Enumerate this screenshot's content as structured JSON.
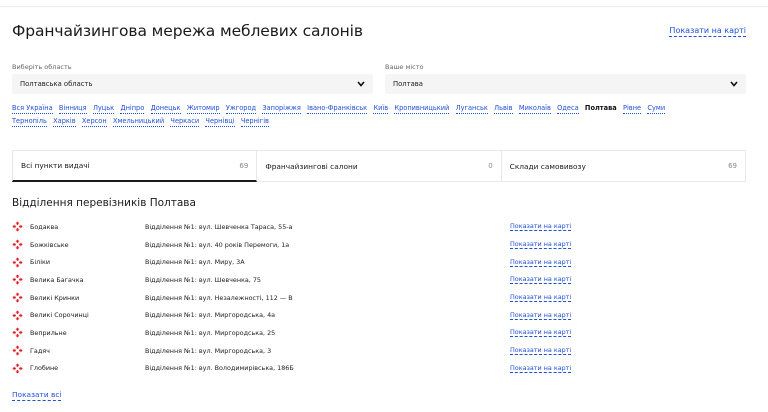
{
  "header": {
    "title": "Франчайзингова мережа меблевих салонів",
    "map_link": "Показати на карті"
  },
  "filters": {
    "region_label": "Виберіть область",
    "region_value": "Полтавська область",
    "city_label": "Ваше місто",
    "city_value": "Полтава"
  },
  "cities_row1": [
    "Вся Україна",
    "Вінниця",
    "Луцьк",
    "Дніпро",
    "Донецьк",
    "Житомир",
    "Ужгород",
    "Запоріжжя",
    "Івано-Франківськ",
    "Київ",
    "Кропивницький",
    "Луганськ",
    "Львів",
    "Миколаїв",
    "Одеса",
    "Полтава",
    "Рівне",
    "Суми"
  ],
  "cities_row2": [
    "Тернопіль",
    "Харків",
    "Херсон",
    "Хмельницький",
    "Черкаси",
    "Чернівці",
    "Чернігів"
  ],
  "active_city": "Полтава",
  "tabs": [
    {
      "label": "Всі пункти видачі",
      "count": "69"
    },
    {
      "label": "Франчайзингові салони",
      "count": "0"
    },
    {
      "label": "Склади самовивозу",
      "count": "69"
    }
  ],
  "section_title": "Відділення перевізників Полтава",
  "rows": [
    {
      "name": "Бодаква",
      "address": "Відділення №1: вул. Шевченка Тараса, 55-а",
      "link": "Показати на карті"
    },
    {
      "name": "Божківське",
      "address": "Відділення №1: вул. 40 років Перемоги, 1а",
      "link": "Показати на карті"
    },
    {
      "name": "Біліки",
      "address": "Відділення №1: вул. Миру, 3А",
      "link": "Показати на карті"
    },
    {
      "name": "Велика Багачка",
      "address": "Відділення №1: вул. Шевченка, 75",
      "link": "Показати на карті"
    },
    {
      "name": "Великі Кринки",
      "address": "Відділення №1: вул. Незалежності, 112 — В",
      "link": "Показати на карті"
    },
    {
      "name": "Великі Сорочинці",
      "address": "Відділення №1: вул. Миргородська, 4а",
      "link": "Показати на карті"
    },
    {
      "name": "Веприльне",
      "address": "Відділення №1: вул. Миргородська, 25",
      "link": "Показати на карті"
    },
    {
      "name": "Гадяч",
      "address": "Відділення №1: вул. Миргородська, 3",
      "link": "Показати на карті"
    },
    {
      "name": "Глобине",
      "address": "Відділення №1: вул. Володимирівська, 186Б",
      "link": "Показати на карті"
    }
  ],
  "show_all": "Показати всі",
  "colors": {
    "link": "#1f4fd6",
    "carrier_icon": "#e22127"
  },
  "icons": {
    "row": "nova-poshta-icon",
    "dropdown": "chevron-down-icon"
  }
}
